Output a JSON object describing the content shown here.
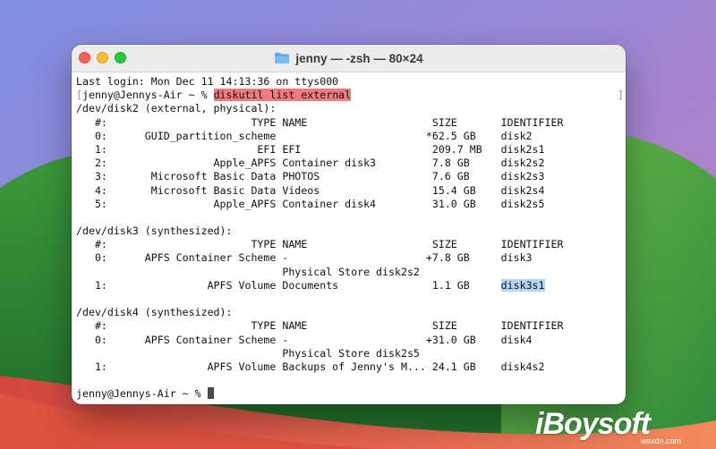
{
  "window": {
    "title": "jenny — -zsh — 80×24",
    "title_icon": "folder-icon"
  },
  "terminal": {
    "last_login": "Last login: Mon Dec 11 14:13:36 on ttys000",
    "prompt": "jenny@Jennys-Air ~ % ",
    "command": "diskutil list external",
    "disk2_header": "/dev/disk2 (external, physical):",
    "disk2_rows": [
      "   #:                       TYPE NAME                    SIZE       IDENTIFIER",
      "   0:      GUID_partition_scheme                        *62.5 GB    disk2",
      "   1:                        EFI EFI                     209.7 MB   disk2s1",
      "   2:                 Apple_APFS Container disk3         7.8 GB     disk2s2",
      "   3:       Microsoft Basic Data PHOTOS                  7.6 GB     disk2s3",
      "   4:       Microsoft Basic Data Videos                  15.4 GB    disk2s4",
      "   5:                 Apple_APFS Container disk4         31.0 GB    disk2s5"
    ],
    "disk3_header": "/dev/disk3 (synthesized):",
    "disk3_rows": [
      "   #:                       TYPE NAME                    SIZE       IDENTIFIER",
      "   0:      APFS Container Scheme -                      +7.8 GB     disk3",
      "                                 Physical Store disk2s2"
    ],
    "disk3_row1_prefix": "   1:                APFS Volume Documents               1.1 GB     ",
    "disk3_row1_identifier": "disk3s1",
    "disk4_header": "/dev/disk4 (synthesized):",
    "disk4_rows": [
      "   #:                       TYPE NAME                    SIZE       IDENTIFIER",
      "   0:      APFS Container Scheme -                      +31.0 GB    disk4",
      "                                 Physical Store disk2s5",
      "   1:                APFS Volume Backups of Jenny's M... 24.1 GB    disk4s2"
    ],
    "final_prompt": "jenny@Jennys-Air ~ % "
  },
  "watermark": {
    "brand": "iBoysoft",
    "site": "wsxdn.com"
  },
  "colors": {
    "command_highlight": "#f07a7c",
    "selection_highlight": "#b3d6f8",
    "traffic_close": "#fe5f57",
    "traffic_minimize": "#febc2e",
    "traffic_zoom": "#28c840"
  }
}
